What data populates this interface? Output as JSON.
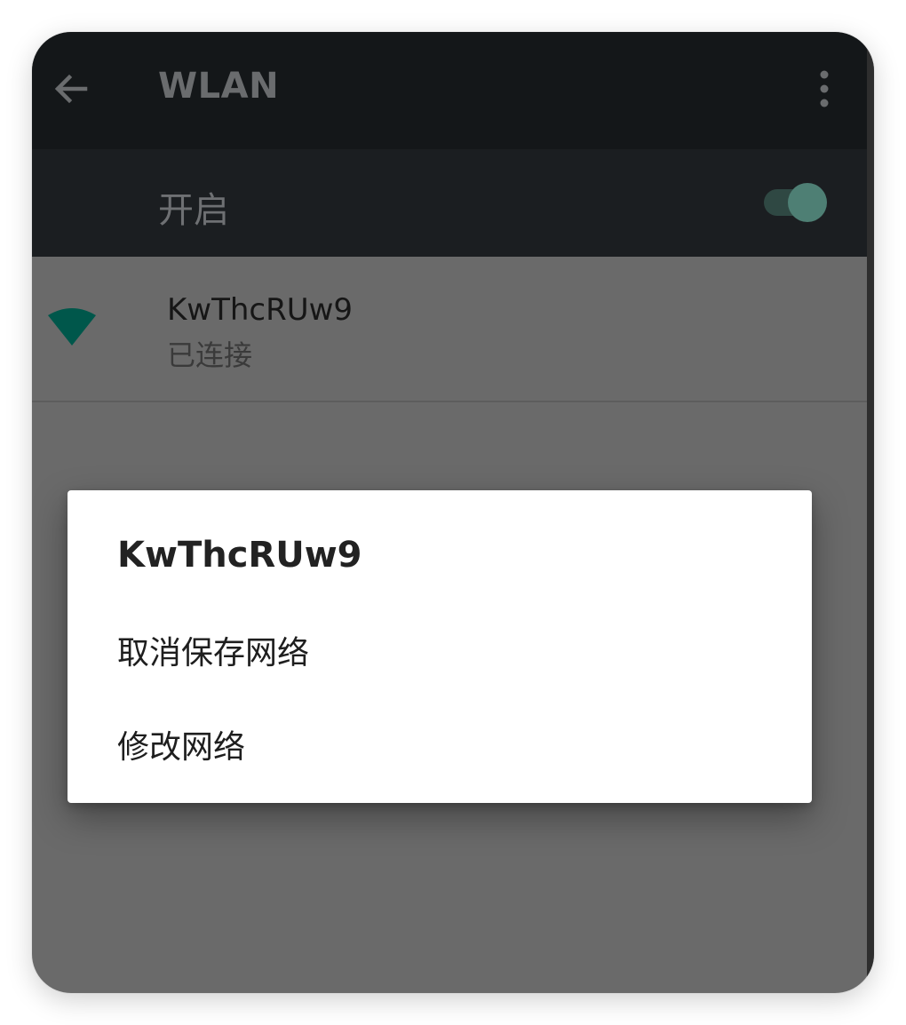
{
  "appbar": {
    "back_icon": "arrow-left-icon",
    "title": "WLAN",
    "more_icon": "more-vert-icon"
  },
  "wifi_switch": {
    "label": "开启",
    "state": "on"
  },
  "network": {
    "icon": "wifi-signal-icon",
    "name": "KwThcRUw9",
    "status": "已连接"
  },
  "dialog": {
    "title": "KwThcRUw9",
    "items": [
      {
        "label": "取消保存网络"
      },
      {
        "label": "修改网络"
      }
    ]
  },
  "colors": {
    "appbar_bg": "#141719",
    "switchbar_bg": "#1b1e21",
    "scrim": "#6a6a6a",
    "accent": "#00574b",
    "dialog_bg": "#ffffff"
  }
}
